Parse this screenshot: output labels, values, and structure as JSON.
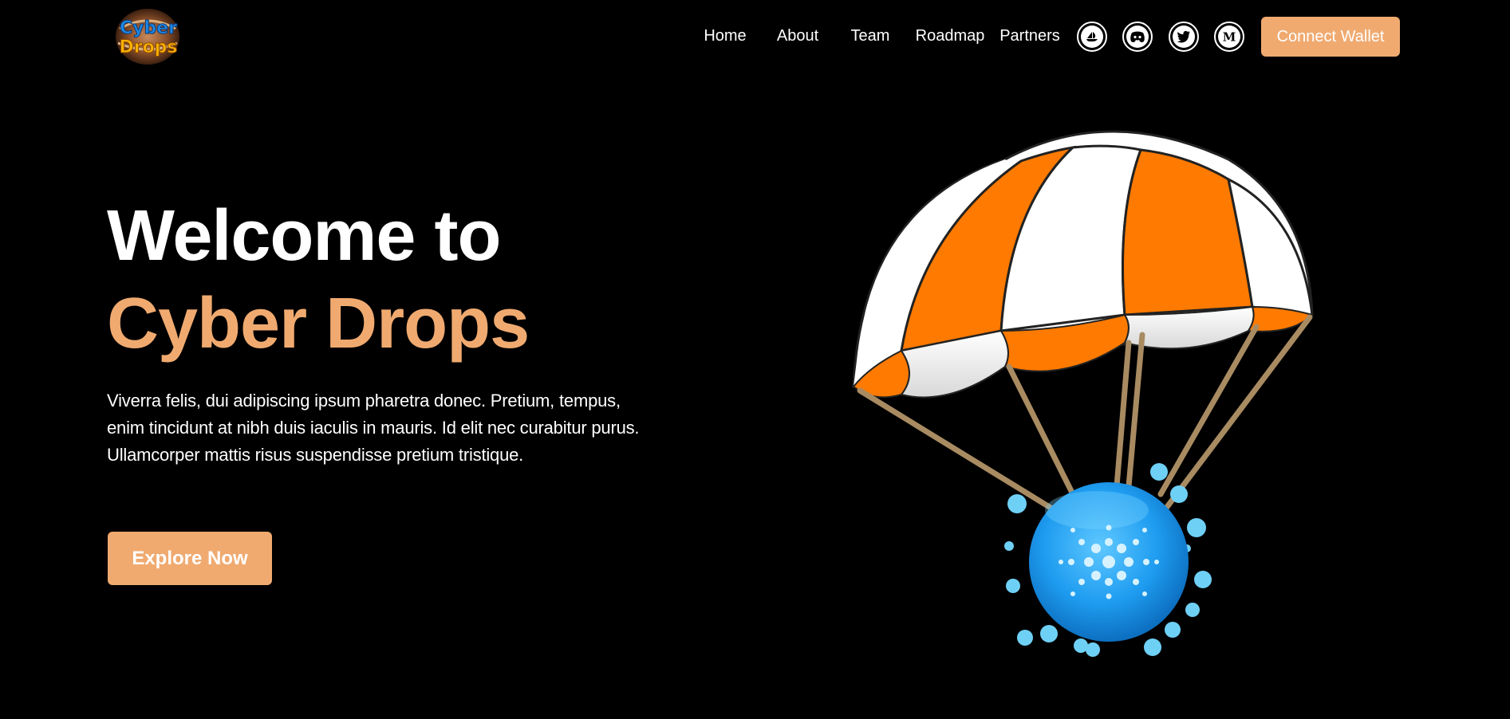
{
  "header": {
    "logo_text_top": "Cyber",
    "logo_text_bottom": "Drops",
    "nav": [
      {
        "label": "Home"
      },
      {
        "label": "About"
      },
      {
        "label": "Team"
      },
      {
        "label": "Roadmap"
      },
      {
        "label": "Partners"
      }
    ],
    "socials": [
      {
        "icon": "opensea-icon"
      },
      {
        "icon": "discord-icon"
      },
      {
        "icon": "twitter-icon"
      },
      {
        "icon": "medium-icon"
      }
    ],
    "connect_label": "Connect Wallet"
  },
  "hero": {
    "title_line1": "Welcome to",
    "title_line2": "Cyber Drops",
    "description": "Viverra felis, dui adipiscing ipsum pharetra donec. Pretium, tempus, enim tincidunt at nibh duis iaculis in mauris. Id elit nec curabitur purus. Ullamcorper mattis risus suspendisse pretium tristique.",
    "cta_label": "Explore Now",
    "illustration": "parachute-coin-illustration"
  },
  "colors": {
    "background": "#000000",
    "accent": "#f0aa70",
    "text": "#ffffff",
    "parachute_orange": "#ff7a00",
    "coin_blue": "#1e9cf0"
  }
}
